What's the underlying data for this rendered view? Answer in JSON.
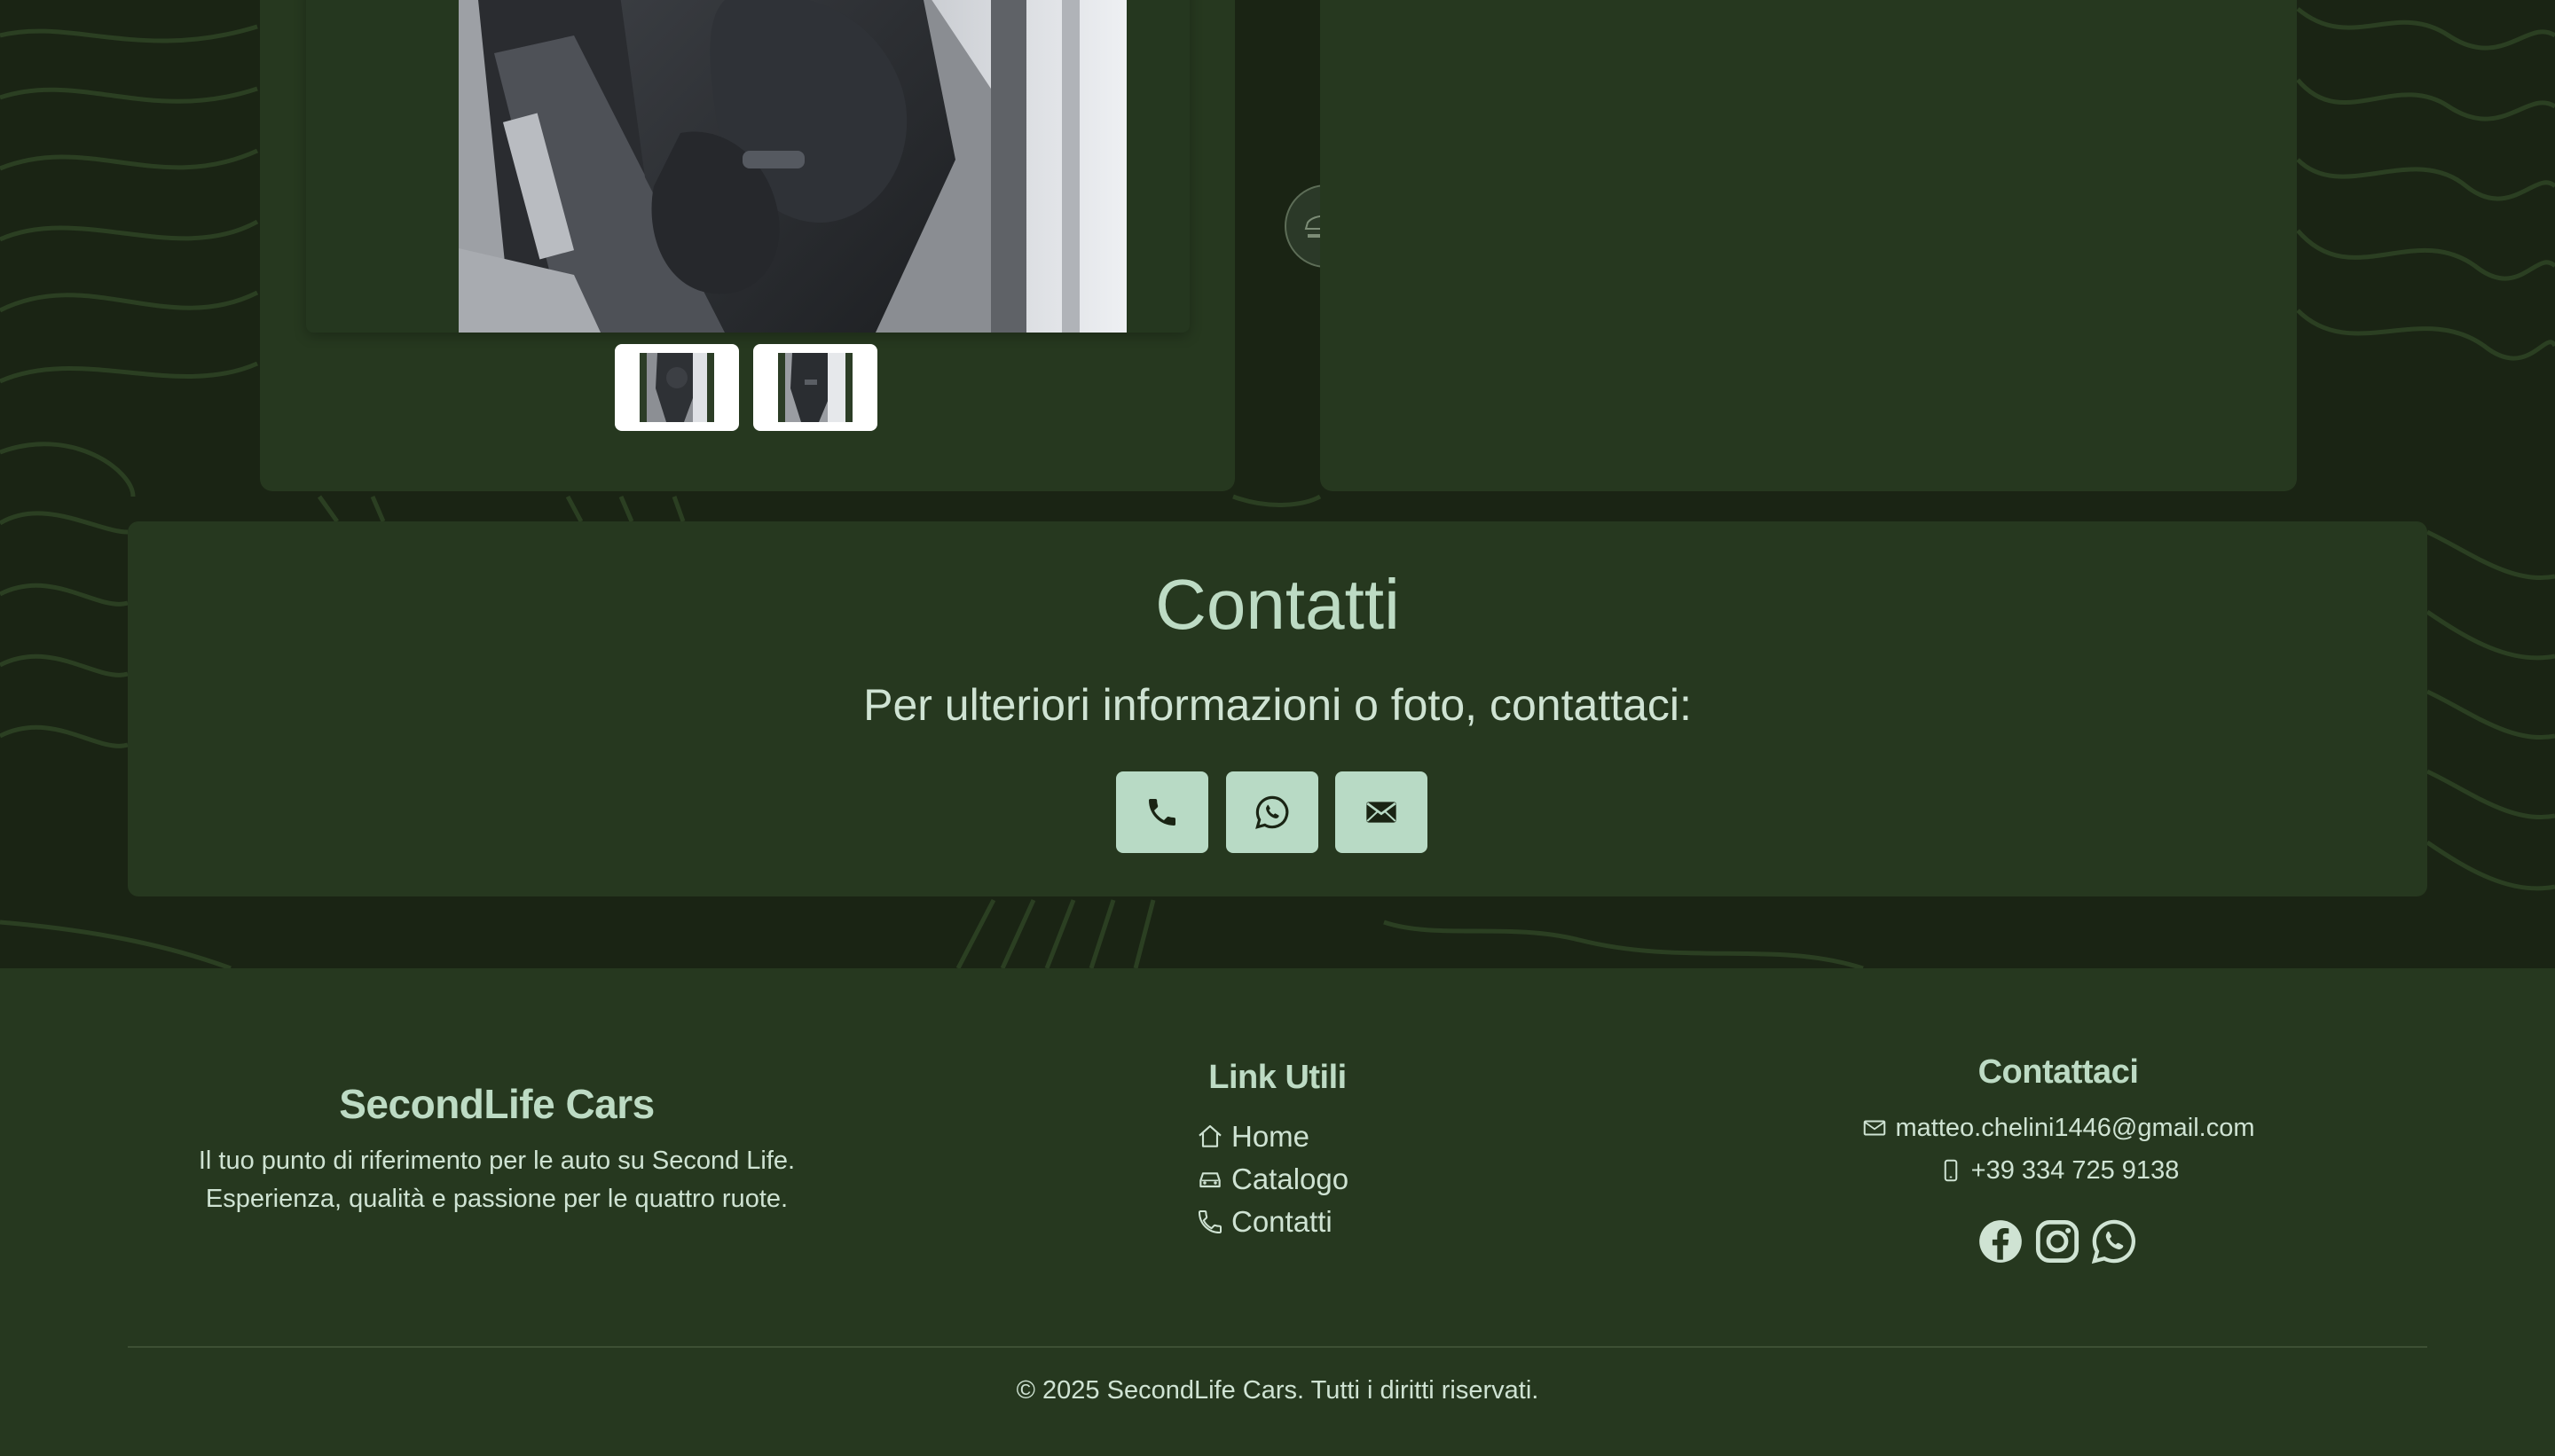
{
  "gallery": {
    "thumbnails": [
      {
        "alt": "car interior thumbnail 1"
      },
      {
        "alt": "car interior thumbnail 2"
      }
    ]
  },
  "contact_section": {
    "title": "Contatti",
    "subtitle": "Per ulteriori informazioni o foto, contattaci:",
    "buttons": [
      {
        "icon": "phone-icon"
      },
      {
        "icon": "whatsapp-icon"
      },
      {
        "icon": "envelope-icon"
      }
    ]
  },
  "footer": {
    "brand": {
      "name": "SecondLife Cars",
      "tagline_line1": "Il tuo punto di riferimento per le auto su Second Life.",
      "tagline_line2": "Esperienza, qualità e passione per le quattro ruote."
    },
    "links": {
      "title": "Link Utili",
      "items": [
        {
          "label": "Home",
          "icon": "house-icon"
        },
        {
          "label": "Catalogo",
          "icon": "car-icon"
        },
        {
          "label": "Contatti",
          "icon": "telephone-icon"
        }
      ]
    },
    "contact": {
      "title": "Contattaci",
      "email": "matteo.chelini1446@gmail.com",
      "phone": "+39 334 725 9138",
      "socials": [
        "facebook-icon",
        "instagram-icon",
        "whatsapp-icon"
      ]
    },
    "copyright": "© 2025 SecondLife Cars. Tutti i diritti riservati."
  },
  "colors": {
    "background": "#1a2414",
    "panel": "#26381f",
    "accent": "#b8dac5",
    "heading": "#bddbc4",
    "text": "#cfe3d3"
  }
}
